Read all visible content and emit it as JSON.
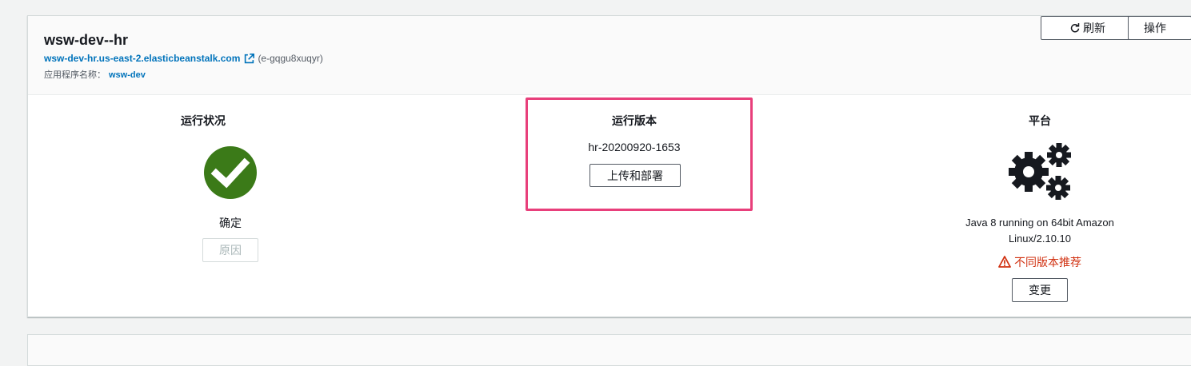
{
  "environment": {
    "name": "wsw-dev--hr",
    "url": "wsw-dev-hr.us-east-2.elasticbeanstalk.com",
    "id": "(e-gqgu8xuqyr)",
    "app_label": "应用程序名称：",
    "app_name": "wsw-dev"
  },
  "toolbar": {
    "refresh_label": "刷新",
    "actions_label": "操作"
  },
  "health": {
    "title": "运行状况",
    "status": "确定",
    "causes_label": "原因",
    "color": "#3b7a18"
  },
  "running_version": {
    "title": "运行版本",
    "label": "hr-20200920-1653",
    "upload_label": "上传和部署",
    "highlight_color": "#e83f7b"
  },
  "platform": {
    "title": "平台",
    "description": "Java 8 running on 64bit Amazon Linux/2.10.10",
    "warning": "不同版本推荐",
    "change_label": "变更",
    "warning_color": "#d13212"
  }
}
